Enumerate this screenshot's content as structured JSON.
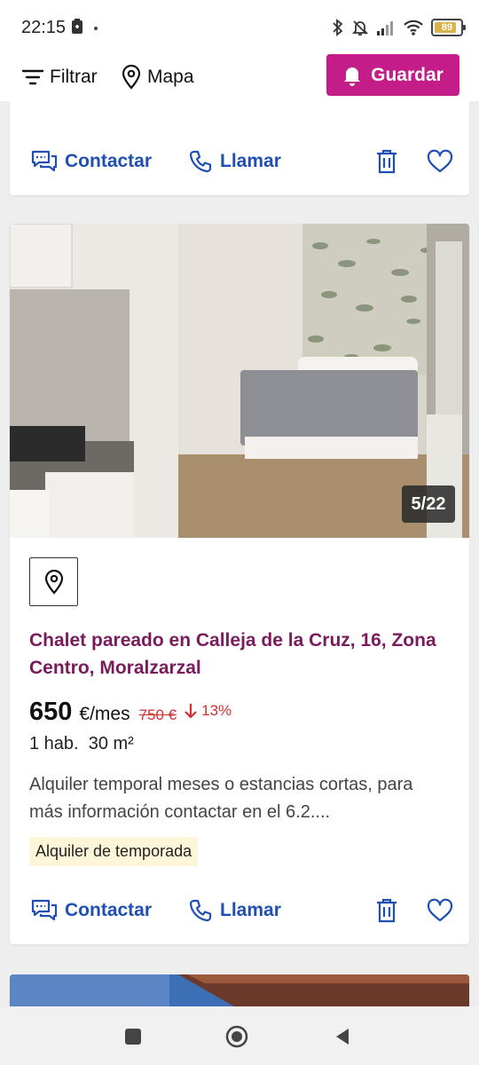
{
  "status_bar": {
    "time": "22:15",
    "battery": "89",
    "battery_level": 0.89,
    "icons": [
      "bluetooth-icon",
      "silent-icon",
      "signal-icon",
      "wifi-icon",
      "battery-icon"
    ]
  },
  "toolbar": {
    "filter_label": "Filtrar",
    "map_label": "Mapa",
    "save_label": "Guardar",
    "accent_color": "#c41c88"
  },
  "listing_prev": {
    "contact_label": "Contactar",
    "call_label": "Llamar"
  },
  "listing": {
    "photo_counter": "5/22",
    "title": "Chalet pareado en Calleja de la Cruz, 16, Zona Centro, Moralzarzal",
    "price": "650",
    "price_unit": "€/mes",
    "old_price": "750 €",
    "discount": "13%",
    "details": "1 hab.  30 m²",
    "description": "Alquiler temporal meses o estancias cortas, para más información contactar en el 6.2....",
    "badge": "Alquiler de temporada",
    "contact_label": "Contactar",
    "call_label": "Llamar",
    "title_color": "#7a1c5c",
    "link_color": "#1f4fb3"
  }
}
